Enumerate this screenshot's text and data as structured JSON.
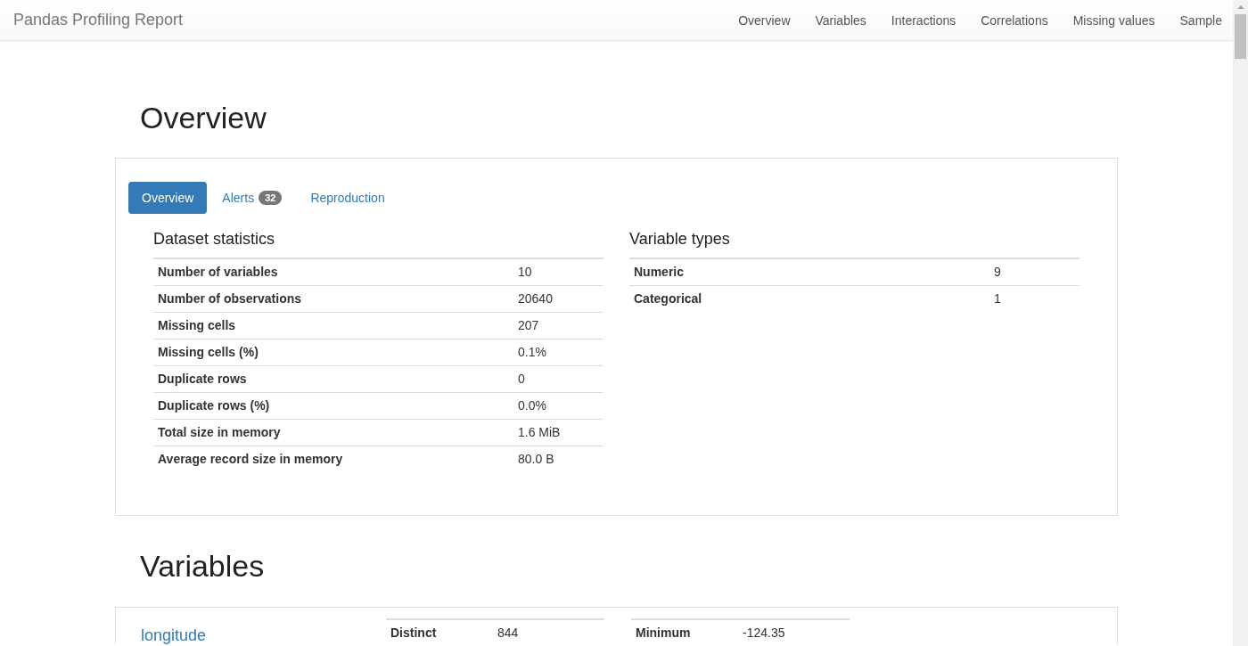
{
  "navbar": {
    "brand": "Pandas Profiling Report",
    "links": [
      "Overview",
      "Variables",
      "Interactions",
      "Correlations",
      "Missing values",
      "Sample"
    ]
  },
  "overview": {
    "title": "Overview",
    "tabs": [
      {
        "label": "Overview",
        "selected": true
      },
      {
        "label": "Alerts",
        "badge": "32",
        "selected": false
      },
      {
        "label": "Reproduction",
        "selected": false
      }
    ],
    "dataset_statistics": {
      "title": "Dataset statistics",
      "rows": [
        {
          "label": "Number of variables",
          "value": "10"
        },
        {
          "label": "Number of observations",
          "value": "20640"
        },
        {
          "label": "Missing cells",
          "value": "207"
        },
        {
          "label": "Missing cells (%)",
          "value": "0.1%"
        },
        {
          "label": "Duplicate rows",
          "value": "0"
        },
        {
          "label": "Duplicate rows (%)",
          "value": "0.0%"
        },
        {
          "label": "Total size in memory",
          "value": "1.6 MiB"
        },
        {
          "label": "Average record size in memory",
          "value": "80.0 B"
        }
      ]
    },
    "variable_types": {
      "title": "Variable types",
      "rows": [
        {
          "label": "Numeric",
          "value": "9"
        },
        {
          "label": "Categorical",
          "value": "1"
        }
      ]
    }
  },
  "variables": {
    "title": "Variables",
    "variable": {
      "name": "longitude",
      "stats_1": [
        {
          "label": "Distinct",
          "value": "844"
        }
      ],
      "stats_2": [
        {
          "label": "Minimum",
          "value": "-124.35"
        }
      ]
    }
  }
}
